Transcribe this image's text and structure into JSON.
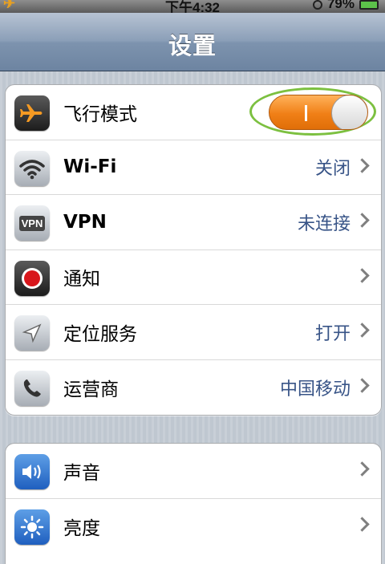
{
  "status_bar": {
    "time": "下午4:32",
    "battery": "79%"
  },
  "nav": {
    "title": "设置"
  },
  "group1": [
    {
      "label": "飞行模式",
      "icon": "airplane-icon",
      "toggle": "on"
    },
    {
      "label": "Wi-Fi",
      "value": "关闭",
      "icon": "wifi-icon"
    },
    {
      "label": "VPN",
      "value": "未连接",
      "icon": "vpn-icon",
      "icon_text": "VPN"
    },
    {
      "label": "通知",
      "value": "",
      "icon": "notification-icon"
    },
    {
      "label": "定位服务",
      "value": "打开",
      "icon": "location-icon"
    },
    {
      "label": "运营商",
      "value": "中国移动",
      "icon": "phone-icon"
    }
  ],
  "group2": [
    {
      "label": "声音",
      "icon": "sound-icon"
    },
    {
      "label": "亮度",
      "icon": "brightness-icon"
    }
  ],
  "colors": {
    "toggle_on": "#f07f16",
    "highlight_ring": "#7cc040",
    "value_text": "#385487",
    "nav_bar": "#7d93ae"
  }
}
